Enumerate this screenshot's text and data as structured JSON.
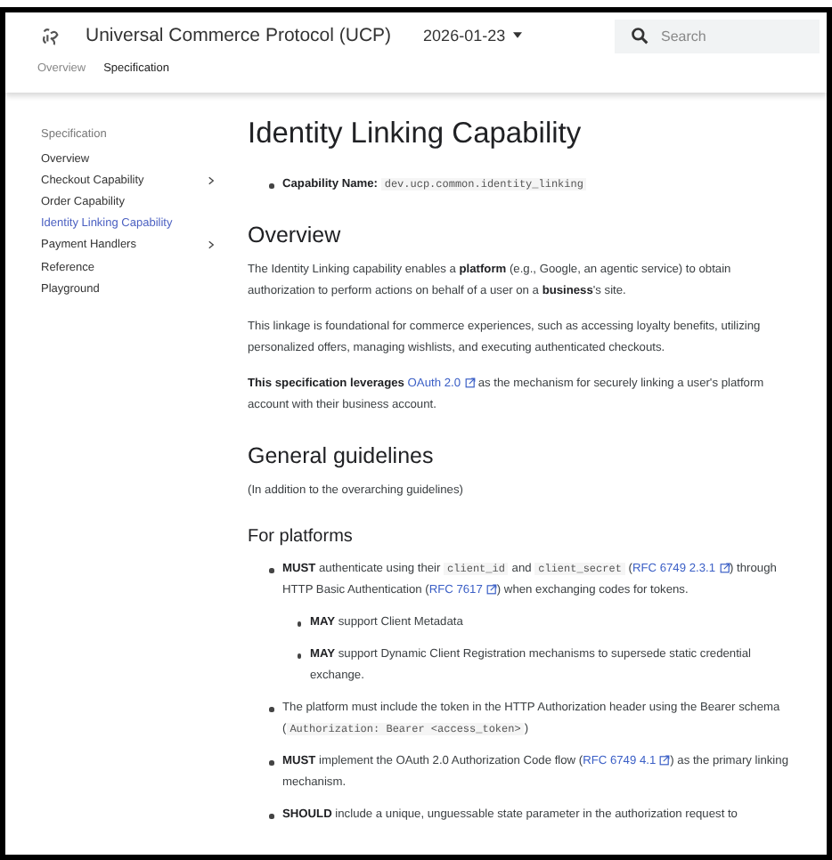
{
  "header": {
    "title": "Universal Commerce Protocol (UCP)",
    "version": "2026-01-23",
    "search": {
      "placeholder": "Search"
    }
  },
  "nav_tabs": [
    {
      "label": "Overview",
      "selected": false
    },
    {
      "label": "Specification",
      "selected": true
    }
  ],
  "sidebar": {
    "heading": "Specification",
    "items": [
      {
        "label": "Overview",
        "selected": false,
        "expandable": false
      },
      {
        "label": "Checkout Capability",
        "selected": false,
        "expandable": true
      },
      {
        "label": "Order Capability",
        "selected": false,
        "expandable": false
      },
      {
        "label": "Identity Linking Capability",
        "selected": true,
        "expandable": false
      },
      {
        "label": "Payment Handlers",
        "selected": false,
        "expandable": true
      },
      {
        "label": "Reference",
        "selected": false,
        "expandable": false
      },
      {
        "label": "Playground",
        "selected": false,
        "expandable": false
      }
    ]
  },
  "article": {
    "title": "Identity Linking Capability",
    "blocks": [
      {
        "kind": "list",
        "items": [
          {
            "segments": [
              {
                "kind": "bold",
                "text": "Capability Name: "
              },
              {
                "kind": "code",
                "text": "dev.ucp.common.identity_linking"
              }
            ]
          }
        ]
      },
      {
        "kind": "h2",
        "text": "Overview"
      },
      {
        "kind": "p",
        "segments": [
          {
            "kind": "text",
            "text": "The Identity Linking capability enables a "
          },
          {
            "kind": "bold",
            "text": "platform"
          },
          {
            "kind": "text",
            "text": " (e.g., Google, an agentic service) to obtain authorization to perform actions on behalf of a user on a "
          },
          {
            "kind": "bold",
            "text": "business"
          },
          {
            "kind": "text",
            "text": "'s site."
          }
        ]
      },
      {
        "kind": "p",
        "segments": [
          {
            "kind": "text",
            "text": "This linkage is foundational for commerce experiences, such as accessing loyalty benefits, utilizing personalized offers, managing wishlists, and executing authenticated checkouts."
          }
        ]
      },
      {
        "kind": "p",
        "segments": [
          {
            "kind": "bold",
            "text": "This specification leverages "
          },
          {
            "kind": "link",
            "text": "OAuth 2.0"
          },
          {
            "kind": "text",
            "text": " as the mechanism for securely linking a user's platform account with their business account."
          }
        ]
      },
      {
        "kind": "h2",
        "text": "General guidelines"
      },
      {
        "kind": "p",
        "segments": [
          {
            "kind": "text",
            "text": "(In addition to the overarching guidelines)"
          }
        ]
      },
      {
        "kind": "h3",
        "text": "For platforms"
      },
      {
        "kind": "list",
        "items": [
          {
            "segments": [
              {
                "kind": "bold",
                "text": "MUST"
              },
              {
                "kind": "text",
                "text": " authenticate using their "
              },
              {
                "kind": "code",
                "text": "client_id"
              },
              {
                "kind": "text",
                "text": " and "
              },
              {
                "kind": "code",
                "text": "client_secret"
              },
              {
                "kind": "text",
                "text": " ("
              },
              {
                "kind": "link",
                "text": "RFC 6749 2.3.1"
              },
              {
                "kind": "text",
                "text": ") through HTTP Basic Authentication ("
              },
              {
                "kind": "link",
                "text": "RFC 7617"
              },
              {
                "kind": "text",
                "text": ") when exchanging codes for tokens."
              }
            ],
            "children": [
              {
                "segments": [
                  {
                    "kind": "bold",
                    "text": "MAY"
                  },
                  {
                    "kind": "text",
                    "text": " support Client Metadata"
                  }
                ]
              },
              {
                "segments": [
                  {
                    "kind": "bold",
                    "text": "MAY"
                  },
                  {
                    "kind": "text",
                    "text": " support Dynamic Client Registration mechanisms to supersede static credential exchange."
                  }
                ]
              }
            ]
          },
          {
            "segments": [
              {
                "kind": "text",
                "text": "The platform must include the token in the HTTP Authorization header using the Bearer schema ("
              },
              {
                "kind": "code",
                "text": "Authorization: Bearer <access_token>"
              },
              {
                "kind": "text",
                "text": ")"
              }
            ]
          },
          {
            "segments": [
              {
                "kind": "bold",
                "text": "MUST"
              },
              {
                "kind": "text",
                "text": " implement the OAuth 2.0 Authorization Code flow ("
              },
              {
                "kind": "link",
                "text": "RFC 6749 4.1"
              },
              {
                "kind": "text",
                "text": ") as the primary linking mechanism."
              }
            ]
          },
          {
            "segments": [
              {
                "kind": "bold",
                "text": "SHOULD"
              },
              {
                "kind": "text",
                "text": " include a unique, unguessable state parameter in the authorization request to"
              }
            ]
          }
        ]
      }
    ]
  }
}
